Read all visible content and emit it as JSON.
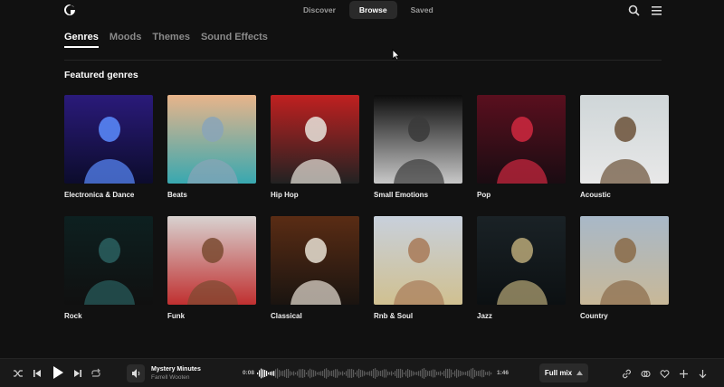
{
  "nav": {
    "items": [
      {
        "label": "Discover",
        "active": false
      },
      {
        "label": "Browse",
        "active": true
      },
      {
        "label": "Saved",
        "active": false
      }
    ]
  },
  "tabs": [
    {
      "label": "Genres",
      "active": true
    },
    {
      "label": "Moods",
      "active": false
    },
    {
      "label": "Themes",
      "active": false
    },
    {
      "label": "Sound Effects",
      "active": false
    }
  ],
  "section": {
    "title": "Featured genres"
  },
  "genres": [
    {
      "label": "Electronica & Dance",
      "colors": [
        "#2a1a7a",
        "#5a8cff",
        "#0c0c2c"
      ]
    },
    {
      "label": "Beats",
      "colors": [
        "#e8b48a",
        "#8aa4b8",
        "#38a8b0"
      ]
    },
    {
      "label": "Hip Hop",
      "colors": [
        "#c02020",
        "#e8e4dc",
        "#222222"
      ]
    },
    {
      "label": "Small Emotions",
      "colors": [
        "#0c0c0c",
        "#3a3a3a",
        "#c8c8c8"
      ]
    },
    {
      "label": "Pop",
      "colors": [
        "#5a0f1e",
        "#d02840",
        "#1a0c12"
      ]
    },
    {
      "label": "Acoustic",
      "colors": [
        "#cfd6d8",
        "#6b5138",
        "#e8e8e8"
      ]
    },
    {
      "label": "Rock",
      "colors": [
        "#0d2020",
        "#2a6060",
        "#101010"
      ]
    },
    {
      "label": "Funk",
      "colors": [
        "#d8d2d0",
        "#7a4a30",
        "#c03030"
      ]
    },
    {
      "label": "Classical",
      "colors": [
        "#5a2c14",
        "#e8e0d4",
        "#1a1410"
      ]
    },
    {
      "label": "Rnb & Soul",
      "colors": [
        "#c8d0dc",
        "#a87a58",
        "#d0c090"
      ]
    },
    {
      "label": "Jazz",
      "colors": [
        "#1a2226",
        "#b8a878",
        "#0c1012"
      ]
    },
    {
      "label": "Country",
      "colors": [
        "#a8b8c8",
        "#8a6a48",
        "#c8b898"
      ]
    }
  ],
  "player": {
    "track_title": "Mystery Minutes",
    "artist": "Farrell Wooten",
    "current_time": "0:08",
    "total_time": "1:46",
    "progress": 0.076,
    "mix_label": "Full mix"
  },
  "icons": {
    "logo": "logo-icon",
    "search": "search-icon",
    "menu": "menu-icon",
    "shuffle": "shuffle-icon",
    "prev": "skip-back-icon",
    "play": "play-icon",
    "next": "skip-forward-icon",
    "repeat": "repeat-icon",
    "volume": "volume-icon",
    "link": "link-icon",
    "similar": "similar-icon",
    "like": "heart-icon",
    "add": "plus-icon",
    "download": "download-icon"
  }
}
